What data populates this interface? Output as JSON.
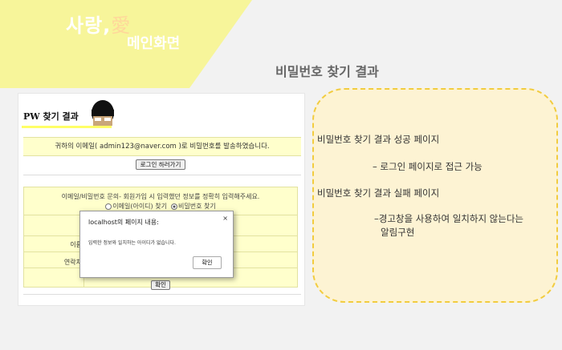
{
  "header": {
    "title_main": "사랑,",
    "title_ai": "愛",
    "title_sub": "메인화면",
    "page_heading": "비밀번호 찾기 결과"
  },
  "screenshot": {
    "section_title": "PW 찾기 결과",
    "notice": "귀하의 이메일( admin123@naver.com )로 비밀번호를 발송하였습니다.",
    "login_button": "로그인 하러가기",
    "inquiry_text": "이메일/비밀번호 문의- 회원가입 시 입력했던 정보를 정확히 입력해주세요.",
    "radio_email": "이메일(아이디) 찾기",
    "radio_password": "비밀번호 찾기",
    "label_name": "이름",
    "label_contact": "연락처",
    "confirm_button": "확인",
    "dialog": {
      "title": "localhost의 페이지 내용:",
      "close": "×",
      "message": "입력한 정보와 일치하는 아이디가 없습니다.",
      "ok": "확인"
    }
  },
  "notes": {
    "success_title": "비밀번호 찾기 결과 성공 페이지",
    "success_detail": "– 로그인 페이지로 접근 가능",
    "fail_title": "비밀번호 찾기 결과 실패 페이지",
    "fail_detail_1": "–경고창을 사용하여 일치하지 않는다는",
    "fail_detail_2": "알림구현"
  },
  "colors": {
    "banner": "#f7f59a",
    "highlight": "#ffffcc",
    "note_bg": "#fdf3d3",
    "note_border": "#f2cc3f"
  }
}
